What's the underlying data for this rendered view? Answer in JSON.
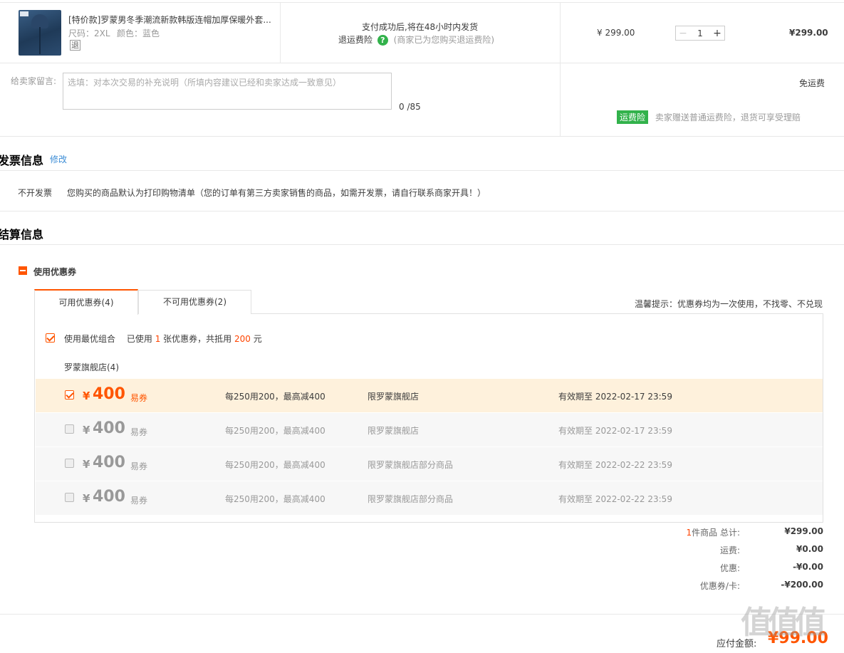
{
  "product": {
    "title": "[特价款]罗蒙男冬季潮流新款韩版连帽加厚保暖外套...",
    "size": "尺码：2XL",
    "color": "颜色：蓝色",
    "refund_mark": "退",
    "ship_note": "支付成功后,将在48小时内发货",
    "insurance_label": "退运费险",
    "insurance_icon": "?",
    "insurance_note": "(商家已为您购买退运费险)",
    "unit_price": "¥ 299.00",
    "quantity": "1",
    "subtotal": "¥299.00"
  },
  "memo": {
    "label": "给卖家留言:",
    "placeholder": "选填：对本次交易的补充说明（所填内容建议已经和卖家达成一致意见）",
    "counter": "0 /85"
  },
  "shipping": {
    "free": "免运费",
    "badge": "运费险",
    "note": "卖家赠送普通运费险，退货可享受理赔"
  },
  "invoice": {
    "title": "发票信息",
    "edit_link": "修改",
    "type": "不开发票",
    "note": "您购买的商品默认为打印购物清单（您的订单有第三方卖家销售的商品，如需开发票，请自行联系商家开具！）"
  },
  "settlement": {
    "title": "结算信息",
    "coupon_toggle": "使用优惠券",
    "tabs": {
      "available": "可用优惠券(4)",
      "unavailable": "不可用优惠券(2)"
    },
    "tip": "温馨提示：优惠券均为一次使用，不找零、不兑现",
    "best_combo_label": "使用最优组合",
    "used_prefix": "已使用",
    "used_count": "1",
    "used_mid": "张优惠券，共抵用",
    "used_amount": "200",
    "used_suffix": "元",
    "shop_name": "罗蒙旗舰店(4)",
    "coupons": [
      {
        "checked": true,
        "yen": "¥",
        "amount": "400",
        "type": "易券",
        "rule": "每250用200，最高减400",
        "scope": "限罗蒙旗舰店",
        "expiry": "有效期至 2022-02-17 23:59"
      },
      {
        "checked": false,
        "yen": "¥",
        "amount": "400",
        "type": "易券",
        "rule": "每250用200，最高减400",
        "scope": "限罗蒙旗舰店",
        "expiry": "有效期至 2022-02-17 23:59"
      },
      {
        "checked": false,
        "yen": "¥",
        "amount": "400",
        "type": "易券",
        "rule": "每250用200，最高减400",
        "scope": "限罗蒙旗舰店部分商品",
        "expiry": "有效期至 2022-02-22 23:59"
      },
      {
        "checked": false,
        "yen": "¥",
        "amount": "400",
        "type": "易券",
        "rule": "每250用200，最高减400",
        "scope": "限罗蒙旗舰店部分商品",
        "expiry": "有效期至 2022-02-22 23:59"
      }
    ]
  },
  "summary": {
    "count": "1",
    "count_label": "件商品 总计:",
    "total": "¥299.00",
    "shipping_label": "运费:",
    "shipping": "¥0.00",
    "discount_label": "优惠:",
    "discount": "-¥0.00",
    "coupon_label": "优惠券/卡:",
    "coupon": "-¥200.00",
    "payable_label": "应付金额:",
    "payable": "¥99.00"
  },
  "watermark": "值值值",
  "colors": {
    "accent": "#ff5500",
    "green": "#32b24b",
    "selected_row": "#fef1dc"
  }
}
